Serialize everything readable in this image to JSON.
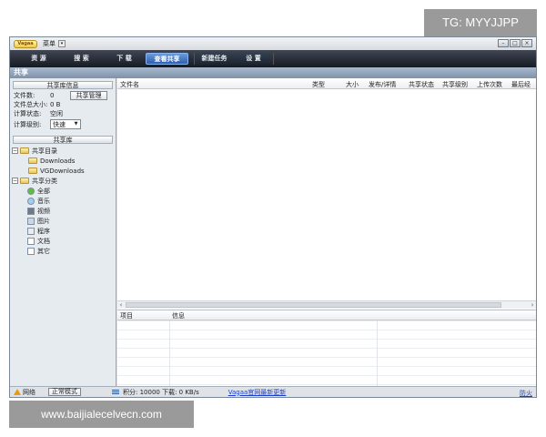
{
  "overlay": {
    "tag": "TG: MYYJJPP",
    "watermark": "www.baijialecelvecn.com"
  },
  "titlebar": {
    "logo": "Vagaa",
    "menu": "菜单"
  },
  "nav": {
    "tabs": [
      "资 源",
      "搜 索",
      "下 载",
      "查看共享"
    ],
    "group": [
      "新建任务",
      "设 置"
    ]
  },
  "section": "共享",
  "left": {
    "info_title": "共享库信息",
    "file_count_label": "文件数:",
    "file_count": "0",
    "total_size_label": "文件总大小:",
    "total_size": "0 B",
    "calc_state_label": "计算状态:",
    "calc_state": "空闲",
    "calc_level_label": "计算级别:",
    "calc_level": "快速",
    "manage_button": "共享管理",
    "library_title": "共享库",
    "tree_dir": "共享目录",
    "dirs": [
      "Downloads",
      "VGDownloads"
    ],
    "tree_cat": "共享分类",
    "cats": [
      "全部",
      "音乐",
      "视频",
      "图片",
      "程序",
      "文档",
      "其它"
    ]
  },
  "list": {
    "columns": [
      "文件名",
      "类型",
      "大小",
      "发布/详情",
      "共享状态",
      "共享级别",
      "上传次数",
      "最后经"
    ]
  },
  "lower": {
    "columns": [
      "项目",
      "信息"
    ]
  },
  "status": {
    "network": "网络",
    "mode": "正常模式",
    "score": "积分: 10000  下载: 0 KB/s",
    "link": "Vagaa官网最新更新",
    "right": "防火"
  }
}
